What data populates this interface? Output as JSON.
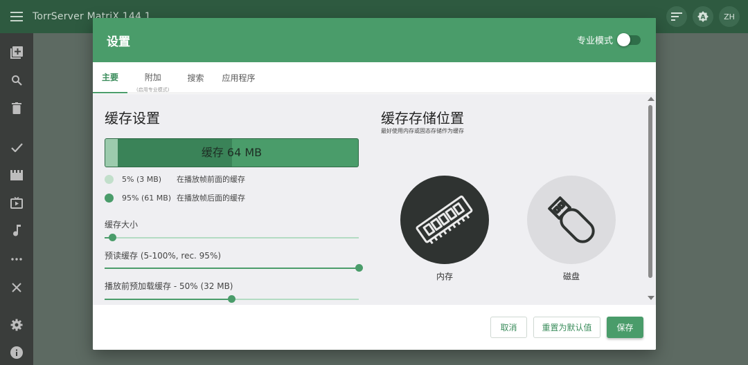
{
  "app": {
    "title": "TorrServer MatriX.144.1"
  },
  "appbar": {
    "sort_icon": "sort-icon",
    "profile_icon": "a-badge-icon",
    "lang_label": "ZH"
  },
  "sidebar": {
    "items": [
      "add-torrent-icon",
      "search-icon",
      "delete-icon",
      "check-icon",
      "movie-icon",
      "tv-icon",
      "music-icon",
      "more-icon",
      "close-icon",
      "settings-icon",
      "info-icon"
    ]
  },
  "dialog": {
    "title": "设置",
    "pro_mode_label": "专业模式",
    "tabs": [
      {
        "label": "主要",
        "sub": ""
      },
      {
        "label": "附加",
        "sub": "(启用专业模式)"
      },
      {
        "label": "搜索",
        "sub": ""
      },
      {
        "label": "应用程序",
        "sub": ""
      }
    ],
    "cache": {
      "title": "缓存设置",
      "bar_label": "缓存 64 MB",
      "before_fraction": 0.05,
      "after_fraction": 0.45,
      "legend": [
        {
          "value": "5% (3 MB)",
          "desc": "在播放帧前面的缓存",
          "color": "#c2dfcb"
        },
        {
          "value": "95% (61 MB)",
          "desc": "在播放帧后面的缓存",
          "color": "#4a9c6a"
        }
      ],
      "sliders": [
        {
          "label": "缓存大小",
          "fraction": 0.03
        },
        {
          "label": "预读缓存 (5-100%, rec. 95%)",
          "fraction": 1.0
        },
        {
          "label": "播放前预加载缓存 - 50% (32 MB)",
          "fraction": 0.5
        }
      ]
    },
    "storage": {
      "title": "缓存存储位置",
      "subtitle": "最好使用内存或固态存储作为缓存",
      "options": [
        {
          "label": "内存",
          "icon": "ram-icon",
          "selected": true
        },
        {
          "label": "磁盘",
          "icon": "usb-drive-icon",
          "selected": false
        }
      ]
    },
    "buttons": {
      "cancel": "取消",
      "reset": "重置为默认值",
      "save": "保存"
    }
  },
  "colors": {
    "accent": "#4a9c6a",
    "appbar": "#2e5a40",
    "sidebar": "#3a3d3b"
  }
}
